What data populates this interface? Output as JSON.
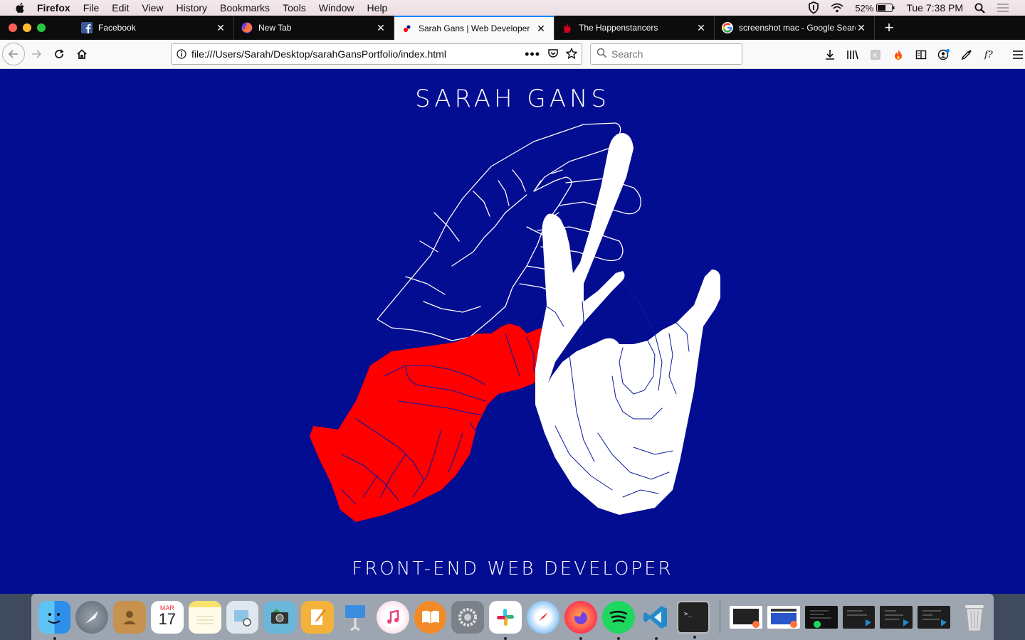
{
  "menubar": {
    "app_name": "Firefox",
    "items": [
      "File",
      "Edit",
      "View",
      "History",
      "Bookmarks",
      "Tools",
      "Window",
      "Help"
    ],
    "battery": "52%",
    "clock": "Tue 7:38 PM"
  },
  "tabs": [
    {
      "title": "Facebook",
      "icon": "facebook-icon",
      "active": false
    },
    {
      "title": "New Tab",
      "icon": "firefox-icon",
      "active": false
    },
    {
      "title": "Sarah Gans | Web Developer",
      "icon": "site-favicon-icon",
      "active": true
    },
    {
      "title": "The Happenstancers",
      "icon": "hand-favicon-icon",
      "active": false
    },
    {
      "title": "screenshot mac - Google Search",
      "icon": "google-icon",
      "active": false
    }
  ],
  "navbar": {
    "url": "file:///Users/Sarah/Desktop/sarahGansPortfolio/index.html",
    "search_placeholder": "Search"
  },
  "page": {
    "title": "SARAH GANS",
    "subtitle": "FRONT-END WEB DEVELOPER",
    "background_color": "#030d91",
    "accent_color": "#ff0000"
  },
  "dock": {
    "apps": [
      "Finder",
      "Launchpad",
      "Contacts",
      "Calendar",
      "Notes",
      "Preview",
      "Image Capture",
      "Pages",
      "Keynote",
      "iTunes",
      "iBooks",
      "System Preferences",
      "Slack",
      "Safari",
      "Firefox",
      "Spotify",
      "Visual Studio Code",
      "Terminal"
    ],
    "calendar_month": "MAR",
    "calendar_day": "17"
  }
}
